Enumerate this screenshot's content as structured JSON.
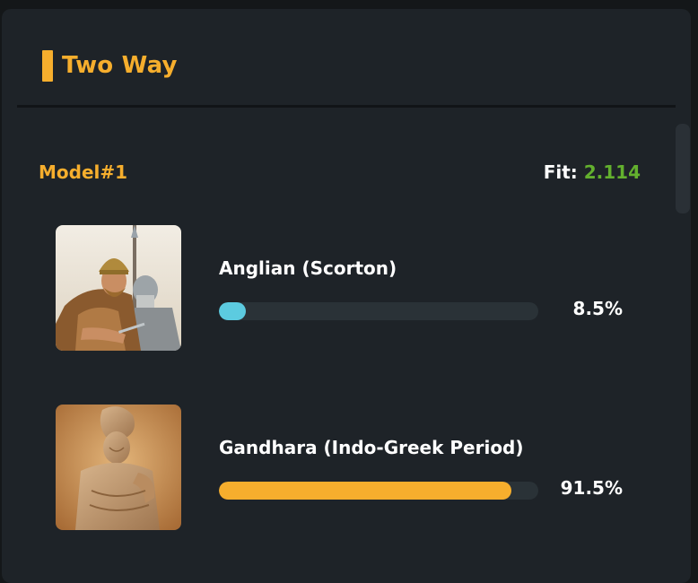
{
  "header": {
    "title": "Two Way",
    "accent_color": "#f6ae2d"
  },
  "model": {
    "label": "Model#1",
    "fit_label": "Fit:",
    "fit_value": "2.114",
    "fit_color": "#63b02e"
  },
  "populations": [
    {
      "name": "Anglian (Scorton)",
      "percent_label": "8.5%",
      "percent": 8.5,
      "bar_color": "#5ccbe0",
      "image": "anglo-saxon-warriors-illustration"
    },
    {
      "name": "Gandhara (Indo-Greek Period)",
      "percent_label": "91.5%",
      "percent": 91.5,
      "bar_color": "#f6ae2d",
      "image": "gandhara-stone-statue"
    }
  ]
}
